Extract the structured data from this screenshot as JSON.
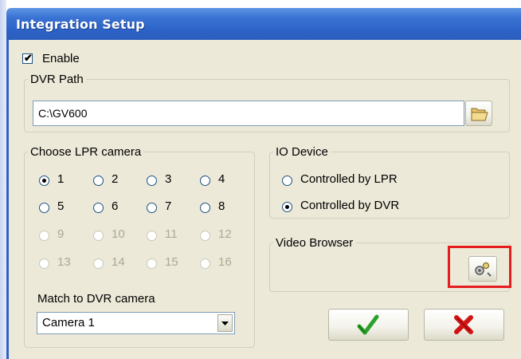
{
  "window": {
    "title": "Integration Setup"
  },
  "enable": {
    "label": "Enable",
    "checked": true
  },
  "dvr_path": {
    "legend": "DVR Path",
    "value": "C:\\GV600",
    "browse_icon": "folder-icon"
  },
  "lpr": {
    "legend": "Choose LPR camera",
    "cameras": [
      {
        "label": "1",
        "selected": true,
        "enabled": true
      },
      {
        "label": "2",
        "selected": false,
        "enabled": true
      },
      {
        "label": "3",
        "selected": false,
        "enabled": true
      },
      {
        "label": "4",
        "selected": false,
        "enabled": true
      },
      {
        "label": "5",
        "selected": false,
        "enabled": true
      },
      {
        "label": "6",
        "selected": false,
        "enabled": true
      },
      {
        "label": "7",
        "selected": false,
        "enabled": true
      },
      {
        "label": "8",
        "selected": false,
        "enabled": true
      },
      {
        "label": "9",
        "selected": false,
        "enabled": false
      },
      {
        "label": "10",
        "selected": false,
        "enabled": false
      },
      {
        "label": "11",
        "selected": false,
        "enabled": false
      },
      {
        "label": "12",
        "selected": false,
        "enabled": false
      },
      {
        "label": "13",
        "selected": false,
        "enabled": false
      },
      {
        "label": "14",
        "selected": false,
        "enabled": false
      },
      {
        "label": "15",
        "selected": false,
        "enabled": false
      },
      {
        "label": "16",
        "selected": false,
        "enabled": false
      }
    ],
    "match_label": "Match to DVR camera",
    "match_value": "Camera 1"
  },
  "io_device": {
    "legend": "IO Device",
    "options": [
      {
        "label": "Controlled by LPR",
        "selected": false
      },
      {
        "label": "Controlled by DVR",
        "selected": true
      }
    ]
  },
  "video_browser": {
    "legend": "Video Browser",
    "button_icon": "settings-icon"
  },
  "buttons": {
    "ok_icon": "checkmark-icon",
    "cancel_icon": "x-icon"
  },
  "colors": {
    "ok": "#2aa12a",
    "cancel": "#d11414",
    "highlight": "#e41e1e"
  }
}
